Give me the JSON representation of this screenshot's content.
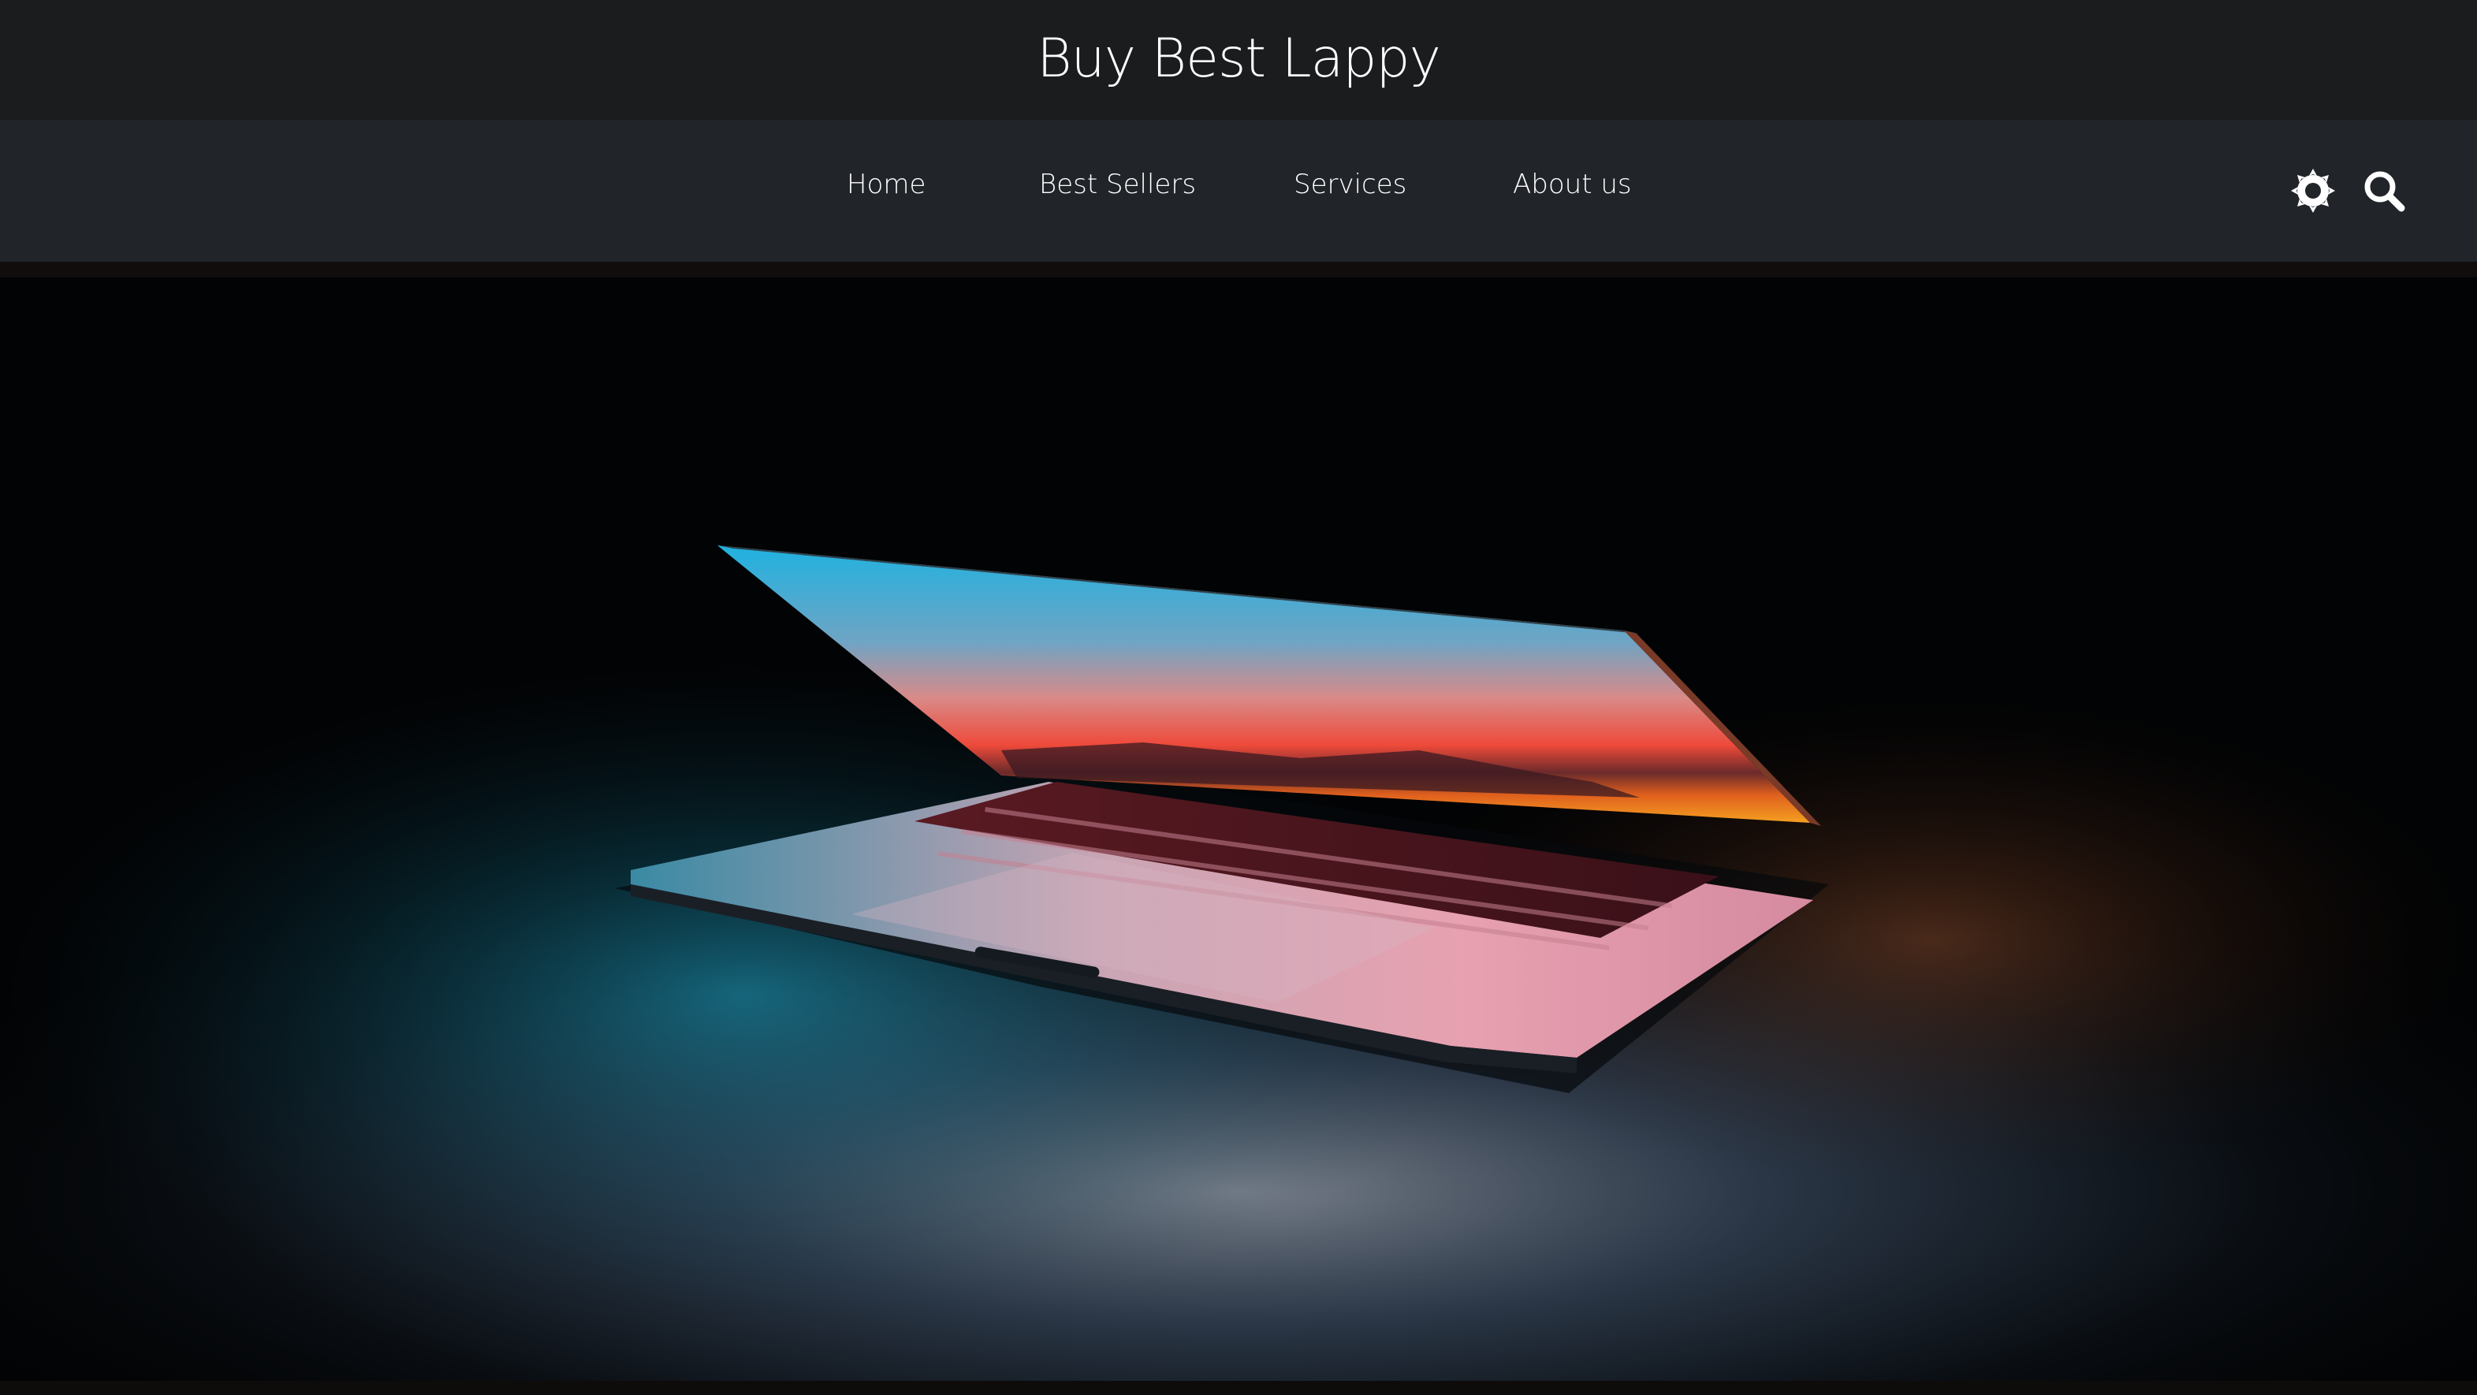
{
  "header": {
    "site_title": "Buy Best Lappy"
  },
  "nav": {
    "items": [
      {
        "label": "Home"
      },
      {
        "label": "Best Sellers"
      },
      {
        "label": "Services"
      },
      {
        "label": "About us"
      }
    ],
    "theme_icon": "sun-gear-icon",
    "search_icon": "search-icon"
  },
  "hero": {
    "image": "half-open-laptop-glowing-in-dark"
  },
  "colors": {
    "header_bg": "#1b1c1e",
    "nav_bg": "#212429",
    "text": "#ffffff"
  }
}
